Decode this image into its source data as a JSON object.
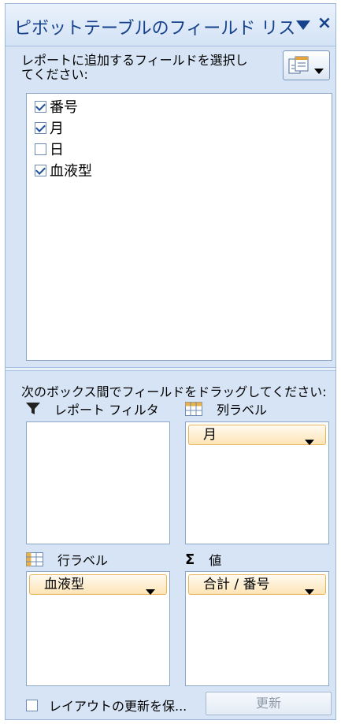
{
  "pane": {
    "title": "ピボットテーブルのフィールド リス",
    "instruction": "レポートに追加するフィールドを選択してください:",
    "layout_button_icon": "field-layout-icon"
  },
  "fields": [
    {
      "label": "番号",
      "checked": true
    },
    {
      "label": "月",
      "checked": true
    },
    {
      "label": "日",
      "checked": false
    },
    {
      "label": "血液型",
      "checked": true
    }
  ],
  "areas": {
    "instruction": "次のボックス間でフィールドをドラッグしてください:",
    "report_filter": {
      "label": "レポート フィルタ",
      "icon": "filter-funnel-icon",
      "items": []
    },
    "column_labels": {
      "label": "列ラベル",
      "icon": "column-grid-icon",
      "items": [
        "月"
      ]
    },
    "row_labels": {
      "label": "行ラベル",
      "icon": "row-grid-icon",
      "items": [
        "血液型"
      ]
    },
    "values": {
      "label": "値",
      "icon": "sigma-icon",
      "items": [
        "合計 / 番号"
      ]
    }
  },
  "footer": {
    "defer_label": "レイアウトの更新を保...",
    "defer_checked": false,
    "update_label": "更新"
  },
  "colors": {
    "title_text": "#15428b",
    "chip_fill": "#fde4b5",
    "pane_bg": "#d6e4f5"
  }
}
